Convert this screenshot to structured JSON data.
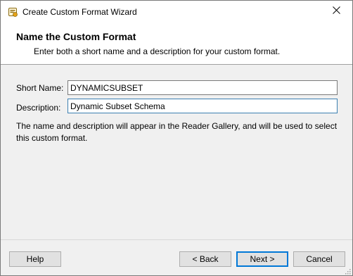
{
  "window": {
    "title": "Create Custom Format Wizard",
    "close_glyph": "✕"
  },
  "header": {
    "title": "Name the Custom Format",
    "subtitle": "Enter both a short name and a description for your custom format."
  },
  "form": {
    "short_name_label": "Short Name:",
    "short_name_value": "DYNAMICSUBSET",
    "description_label": "Description:",
    "description_value": "Dynamic Subset Schema",
    "info": "The name and description will appear in the Reader Gallery, and will be used to select this custom format."
  },
  "buttons": {
    "help": "Help",
    "back": "< Back",
    "next": "Next >",
    "cancel": "Cancel"
  },
  "colors": {
    "focus_border": "#3c7fb1",
    "default_button_border": "#0078d7",
    "icon_accent": "#e8a317"
  },
  "icons": {
    "app": "wizard-app-icon",
    "close": "close-icon",
    "grip": "resize-grip-icon"
  }
}
